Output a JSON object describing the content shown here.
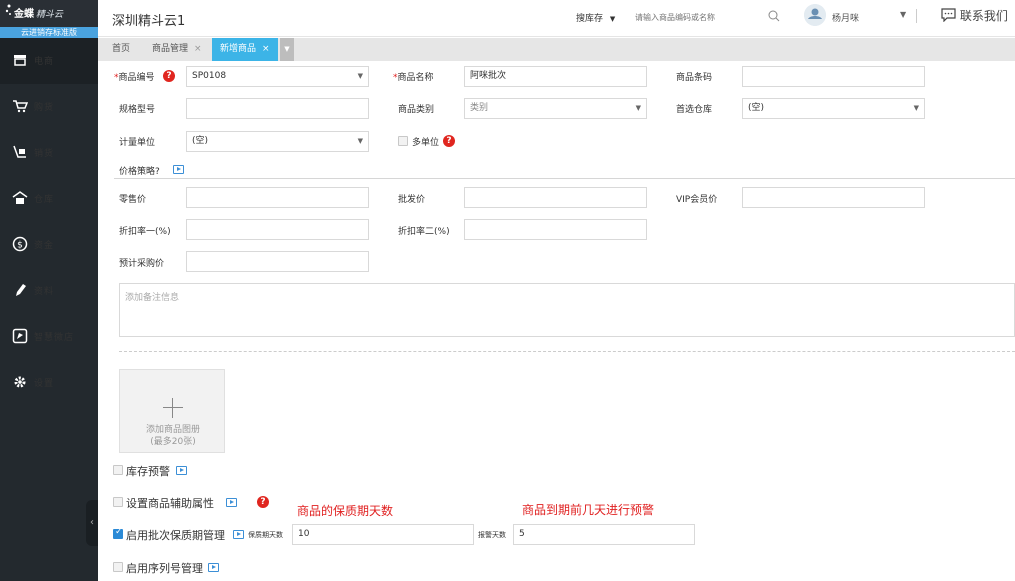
{
  "sidebar": {
    "brand": "金蝶",
    "brand_sub": "精斗云",
    "edition": "云进销存标准版",
    "items": [
      {
        "label": "电商"
      },
      {
        "label": "购货"
      },
      {
        "label": "销货"
      },
      {
        "label": "仓库"
      },
      {
        "label": "资金"
      },
      {
        "label": "资料"
      },
      {
        "label": "智慧微店"
      },
      {
        "label": "设置"
      }
    ],
    "collapse_glyph": "‹"
  },
  "header": {
    "company": "深圳精斗云1",
    "search_scope": "搜库存",
    "search_placeholder": "请输入商品编码或名称",
    "username": "杨月咪",
    "contact": "联系我们"
  },
  "tabs": [
    {
      "label": "首页"
    },
    {
      "label": "商品管理",
      "close": "×"
    },
    {
      "label": "新增商品",
      "close": "×"
    }
  ],
  "form": {
    "code_label": "商品编号",
    "code_value": "SP0108",
    "name_label": "商品名称",
    "name_value": "阿咪批次",
    "barcode_label": "商品条码",
    "barcode_value": "",
    "spec_label": "规格型号",
    "spec_value": "",
    "category_label": "商品类别",
    "category_placeholder": "类别",
    "warehouse_label": "首选仓库",
    "warehouse_value": "(空)",
    "unit_label": "计量单位",
    "unit_value": "(空)",
    "multi_unit_label": "多单位",
    "price_strategy_label": "价格策略?",
    "retail_label": "零售价",
    "wholesale_label": "批发价",
    "vip_label": "VIP会员价",
    "discount1_label": "折扣率一(%)",
    "discount2_label": "折扣率二(%)",
    "purchase_label": "预计采购价",
    "remark_placeholder": "添加备注信息",
    "upload_line1": "添加商品图册",
    "upload_line2": "(最多20张)",
    "stock_alert_label": "库存预警",
    "aux_attr_label": "设置商品辅助属性",
    "batch_label": "启用批次保质期管理",
    "shelf_life_label": "保质期天数",
    "shelf_life_value": "10",
    "alert_days_label": "报警天数",
    "alert_days_value": "5",
    "serial_label": "启用序列号管理",
    "help_glyph": "?"
  },
  "annotations": {
    "shelf_life_note": "商品的保质期天数",
    "alert_note": "商品到期前几天进行预警"
  }
}
